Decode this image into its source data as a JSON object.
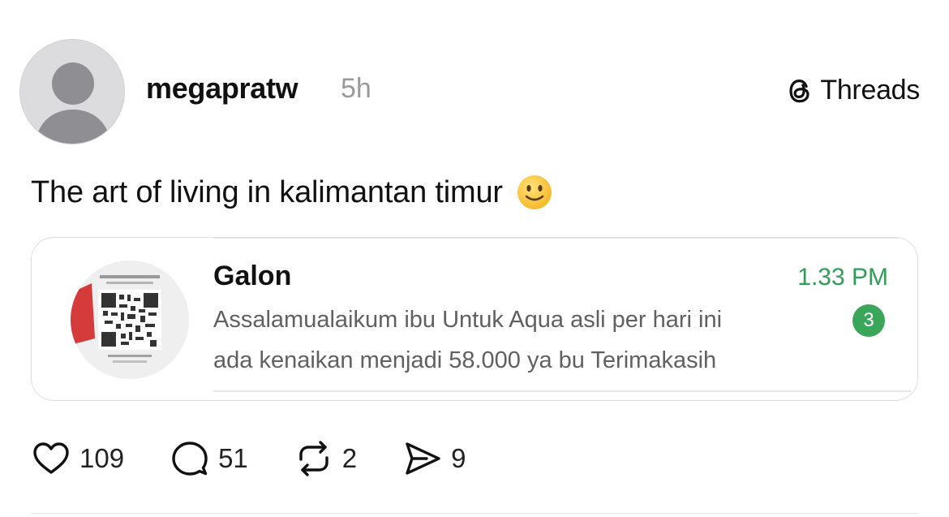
{
  "post": {
    "username": "megapratw",
    "time": "5h",
    "caption": "The art of living in kalimantan timur",
    "caption_emoji": "slightly-smiling-face"
  },
  "brand": {
    "label": "Threads",
    "icon": "threads-logo-icon"
  },
  "embedded_chat": {
    "name": "Galon",
    "time": "1.33 PM",
    "message_line1": "Assalamualaikum ibu Untuk Aqua asli per hari ini",
    "message_line2": "ada kenaikan menjadi 58.000 ya bu Terimakasih",
    "unread_count": "3",
    "accent_color": "#2e9d57"
  },
  "actions": {
    "likes": "109",
    "replies": "51",
    "reposts": "2",
    "shares": "9"
  }
}
